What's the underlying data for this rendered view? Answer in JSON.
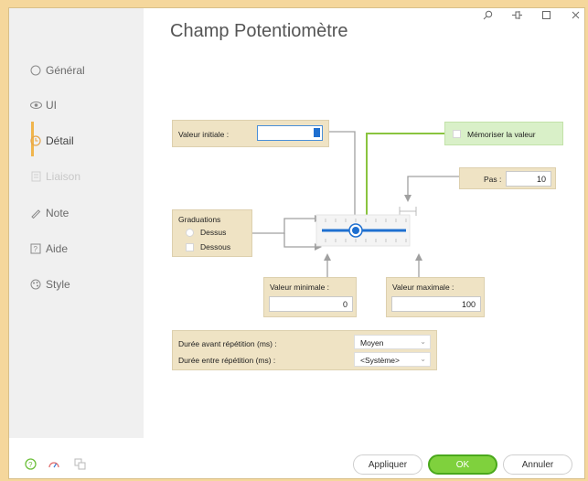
{
  "window": {
    "title": "Champ Potentiomètre",
    "controls": {
      "search_icon": "search-icon",
      "pin_icon": "pin-icon",
      "maximize_icon": "maximize-icon",
      "close_icon": "close-icon"
    }
  },
  "sidebar": {
    "items": [
      {
        "label": "Général",
        "icon": "radio-icon",
        "state": "normal"
      },
      {
        "label": "UI",
        "icon": "eye-icon",
        "state": "normal"
      },
      {
        "label": "Détail",
        "icon": "detail-icon",
        "state": "active"
      },
      {
        "label": "Liaison",
        "icon": "link-icon",
        "state": "disabled"
      },
      {
        "label": "Note",
        "icon": "pencil-icon",
        "state": "normal"
      },
      {
        "label": "Aide",
        "icon": "help-icon",
        "state": "normal"
      },
      {
        "label": "Style",
        "icon": "palette-icon",
        "state": "normal"
      }
    ]
  },
  "detail": {
    "initial_value_label": "Valeur initiale :",
    "memorize_label": "Mémoriser la valeur",
    "step_label": "Pas :",
    "step_value": "10",
    "graduations_label": "Graduations",
    "above_label": "Dessus",
    "below_label": "Dessous",
    "min_label": "Valeur minimale :",
    "min_value": "0",
    "max_label": "Valeur maximale :",
    "max_value": "100",
    "delay_before_label": "Durée avant répétition (ms) :",
    "delay_before_value": "Moyen",
    "delay_between_label": "Durée entre répétition (ms) :",
    "delay_between_value": "<Système>"
  },
  "footer": {
    "apply_label": "Appliquer",
    "ok_label": "OK",
    "cancel_label": "Annuler"
  },
  "colors": {
    "accent": "#f0b54d",
    "panel": "#efe3c4",
    "memorize_panel": "#d9f0c8",
    "ok_green": "#7fd13d",
    "slider_blue": "#1e6fd0"
  }
}
